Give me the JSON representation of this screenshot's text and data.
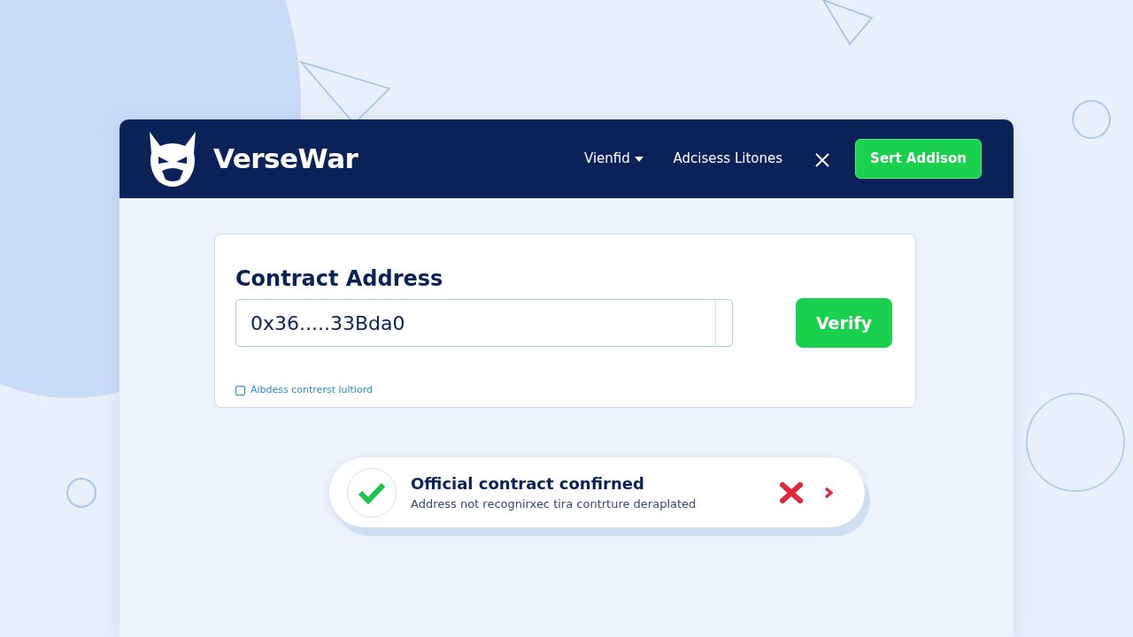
{
  "header": {
    "brand": "VerseWar",
    "nav": [
      {
        "label": "Vienfid",
        "kind": "dropdown"
      },
      {
        "label": "Adcisess Litones",
        "kind": "link"
      }
    ],
    "action_button": "Sert Addison"
  },
  "card": {
    "title": "Contract Address",
    "address_input": {
      "value": "0x36.....33Bda0"
    },
    "verify_button": "Verify",
    "checkbox": {
      "label": "Aibdess contrerst lultiord",
      "checked": false
    }
  },
  "toast": {
    "kind": "success",
    "title": "Official contract confirned",
    "message": "Address not recognirxec tira contrture deraplated"
  }
}
